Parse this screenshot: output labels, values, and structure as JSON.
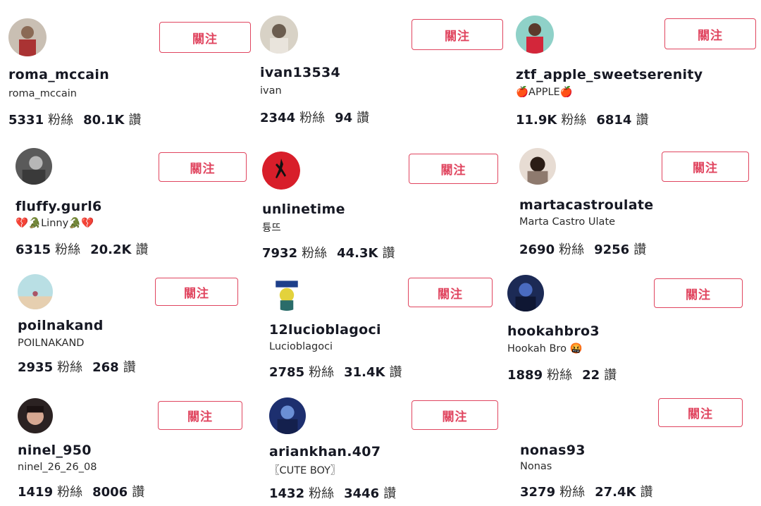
{
  "users": [
    {
      "username": "roma_mccain",
      "nickname": "roma_mccain",
      "followers": "5331",
      "likes": "80.1K",
      "follow_label": "關注",
      "avatar": "avatar-roma"
    },
    {
      "username": "ivan13534",
      "nickname": "ivan",
      "followers": "2344",
      "likes": "94",
      "follow_label": "關注",
      "avatar": "avatar-ivan"
    },
    {
      "username": "ztf_apple_sweetserenity",
      "nickname": "🍎APPLE🍎",
      "followers": "11.9K",
      "likes": "6814",
      "follow_label": "關注",
      "avatar": "avatar-ztf"
    },
    {
      "username": "fluffy.gurl6",
      "nickname": "💔🐊Linny🐊💔",
      "followers": "6315",
      "likes": "20.2K",
      "follow_label": "關注",
      "avatar": "avatar-fluffy"
    },
    {
      "username": "unlinetime",
      "nickname": "튱뜨",
      "followers": "7932",
      "likes": "44.3K",
      "follow_label": "關注",
      "avatar": "avatar-unlinetime"
    },
    {
      "username": "martacastroulate",
      "nickname": "Marta Castro Ulate",
      "followers": "2690",
      "likes": "9256",
      "follow_label": "關注",
      "avatar": "avatar-marta"
    },
    {
      "username": "poilnakand",
      "nickname": "POILNAKAND",
      "followers": "2935",
      "likes": "268",
      "follow_label": "關注",
      "avatar": "avatar-poilnakand"
    },
    {
      "username": "12lucioblagoci",
      "nickname": "Lucioblagoci",
      "followers": "2785",
      "likes": "31.4K",
      "follow_label": "關注",
      "avatar": "avatar-lucio"
    },
    {
      "username": "hookahbro3",
      "nickname": "Hookah Bro 🤬",
      "followers": "1889",
      "likes": "22",
      "follow_label": "關注",
      "avatar": "avatar-hookah"
    },
    {
      "username": "ninel_950",
      "nickname": "ninel_26_26_08",
      "followers": "1419",
      "likes": "8006",
      "follow_label": "關注",
      "avatar": "avatar-ninel"
    },
    {
      "username": "ariankhan.407",
      "nickname": "〖CUTE BOY〗",
      "followers": "1432",
      "likes": "3446",
      "follow_label": "關注",
      "avatar": "avatar-arian"
    },
    {
      "username": "nonas93",
      "nickname": "Nonas",
      "followers": "3279",
      "likes": "27.4K",
      "follow_label": "關注",
      "avatar": ""
    }
  ],
  "labels": {
    "followers": "粉絲",
    "likes": "讚"
  },
  "colors": {
    "accent": "#e0455f",
    "text": "#161823"
  }
}
